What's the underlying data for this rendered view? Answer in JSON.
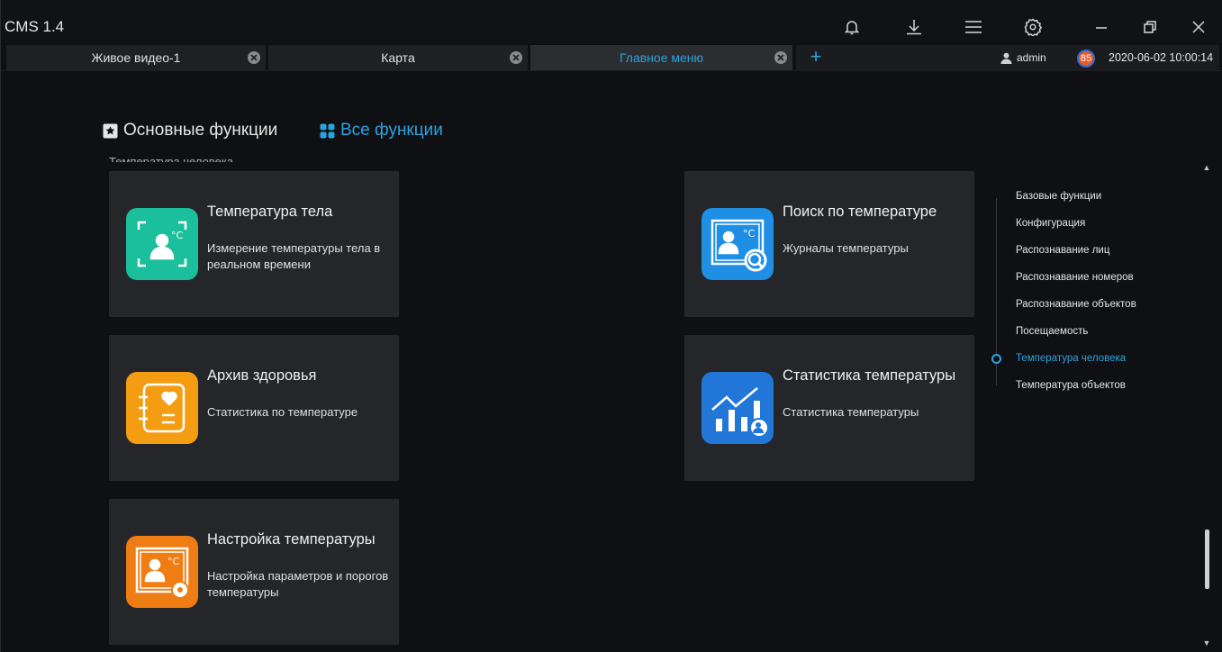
{
  "window": {
    "title": "CMS 1.4"
  },
  "titlebar_icons": [
    "bell-icon",
    "download-icon",
    "menu-icon",
    "settings-icon",
    "minimize-icon",
    "restore-icon",
    "close-icon"
  ],
  "tabs": [
    {
      "label": "Живое видео-1",
      "active": false
    },
    {
      "label": "Карта",
      "active": false
    },
    {
      "label": "Главное меню",
      "active": true
    }
  ],
  "status": {
    "user": "admin",
    "badge": "85",
    "datetime": "2020-06-02 10:00:14"
  },
  "function_tabs": {
    "basic": "Основные функции",
    "all": "Все функции"
  },
  "section": {
    "label": "Температура человека"
  },
  "cards": [
    {
      "title": "Температура тела",
      "desc": "Измерение температуры тела в реальном времени",
      "icon": "body-temperature-icon",
      "color": "#1bbf9c"
    },
    {
      "title": "Поиск по температуре",
      "desc": "Журналы температуры",
      "icon": "temperature-search-icon",
      "color": "#1f8fe6"
    },
    {
      "title": "Архив здоровья",
      "desc": "Статистика по температуре",
      "icon": "health-archive-icon",
      "color": "#f59d12"
    },
    {
      "title": "Статистика температуры",
      "desc": "Статистика температуры",
      "icon": "temperature-statistics-icon",
      "color": "#2276d8"
    },
    {
      "title": "Настройка температуры",
      "desc": "Настройка параметров и порогов температуры",
      "icon": "temperature-settings-icon",
      "color": "#f07d14"
    }
  ],
  "nav": [
    {
      "label": "Базовые функции",
      "active": false
    },
    {
      "label": "Конфигурация",
      "active": false
    },
    {
      "label": "Распознавание лиц",
      "active": false
    },
    {
      "label": "Распознавание номеров",
      "active": false
    },
    {
      "label": "Распознавание объектов",
      "active": false
    },
    {
      "label": "Посещаемость",
      "active": false
    },
    {
      "label": "Температура человека",
      "active": true
    },
    {
      "label": "Температура объектов",
      "active": false
    }
  ],
  "accent_color": "#2ba3de"
}
